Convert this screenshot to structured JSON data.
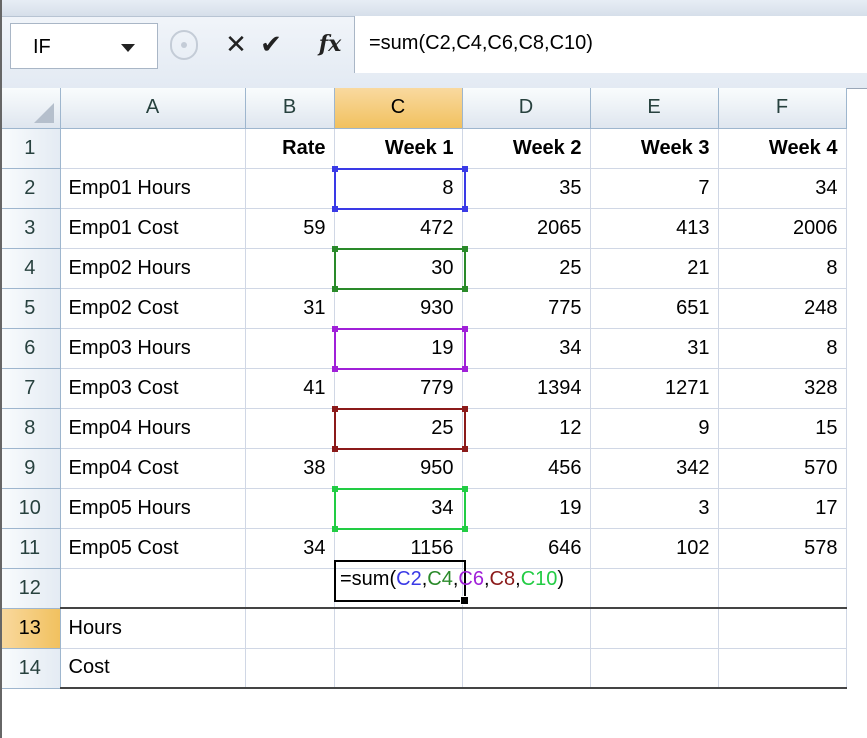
{
  "name_box": {
    "value": "IF"
  },
  "formula_bar": {
    "cancel_icon": "x-icon",
    "enter_icon": "check-icon",
    "fx_label": "fx",
    "formula": "=sum(C2,C4,C6,C8,C10)"
  },
  "columns": [
    "A",
    "B",
    "C",
    "D",
    "E",
    "F"
  ],
  "selected_column": "C",
  "selected_row": "13",
  "rows": [
    {
      "num": "1",
      "a": "",
      "b": "Rate",
      "c": "Week 1",
      "d": "Week 2",
      "e": "Week 3",
      "f": "Week 4"
    },
    {
      "num": "2",
      "a": "Emp01 Hours",
      "b": "",
      "c": "8",
      "d": "35",
      "e": "7",
      "f": "34"
    },
    {
      "num": "3",
      "a": "Emp01 Cost",
      "b": "59",
      "c": "472",
      "d": "2065",
      "e": "413",
      "f": "2006"
    },
    {
      "num": "4",
      "a": "Emp02 Hours",
      "b": "",
      "c": "30",
      "d": "25",
      "e": "21",
      "f": "8"
    },
    {
      "num": "5",
      "a": "Emp02 Cost",
      "b": "31",
      "c": "930",
      "d": "775",
      "e": "651",
      "f": "248"
    },
    {
      "num": "6",
      "a": "Emp03 Hours",
      "b": "",
      "c": "19",
      "d": "34",
      "e": "31",
      "f": "8"
    },
    {
      "num": "7",
      "a": "Emp03 Cost",
      "b": "41",
      "c": "779",
      "d": "1394",
      "e": "1271",
      "f": "328"
    },
    {
      "num": "8",
      "a": "Emp04 Hours",
      "b": "",
      "c": "25",
      "d": "12",
      "e": "9",
      "f": "15"
    },
    {
      "num": "9",
      "a": "Emp04 Cost",
      "b": "38",
      "c": "950",
      "d": "456",
      "e": "342",
      "f": "570"
    },
    {
      "num": "10",
      "a": "Emp05 Hours",
      "b": "",
      "c": "34",
      "d": "19",
      "e": "3",
      "f": "17"
    },
    {
      "num": "11",
      "a": "Emp05 Cost",
      "b": "34",
      "c": "1156",
      "d": "646",
      "e": "102",
      "f": "578"
    },
    {
      "num": "12",
      "a": "",
      "b": "",
      "c": "",
      "d": "",
      "e": "",
      "f": ""
    },
    {
      "num": "13",
      "a": "Hours",
      "b": "",
      "c": "",
      "d": "",
      "e": "",
      "f": ""
    },
    {
      "num": "14",
      "a": "Cost",
      "b": "",
      "c": "",
      "d": "",
      "e": "",
      "f": ""
    }
  ],
  "editing": {
    "parts": [
      {
        "text": "=sum(",
        "color": "#000000"
      },
      {
        "text": "C2",
        "color": "#3a3ae6"
      },
      {
        "text": ",",
        "color": "#000000"
      },
      {
        "text": "C4",
        "color": "#2a8a2a"
      },
      {
        "text": ",",
        "color": "#000000"
      },
      {
        "text": "C6",
        "color": "#a020d8"
      },
      {
        "text": ",",
        "color": "#000000"
      },
      {
        "text": "C8",
        "color": "#8b1a1a"
      },
      {
        "text": ",",
        "color": "#000000"
      },
      {
        "text": "C10",
        "color": "#22cc44"
      },
      {
        "text": ")",
        "color": "#000000"
      }
    ]
  },
  "reference_colors": {
    "C2": "#3a3ae6",
    "C4": "#2a8a2a",
    "C6": "#a020d8",
    "C8": "#8b1a1a",
    "C10": "#22cc44"
  }
}
